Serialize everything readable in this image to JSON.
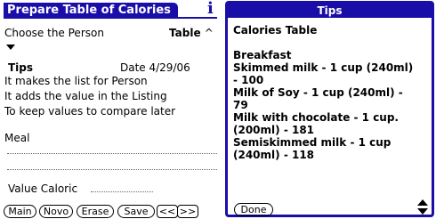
{
  "form": {
    "title": "Prepare Table of Calories",
    "info_icon": "i",
    "person_label": "Choose the Person",
    "category_trigger": "Table",
    "tips_label": "Tips",
    "date_label": "Date 4/29/06",
    "tip_lines": [
      "It makes the list for Person",
      "It adds the value in the Listing",
      "To keep values to compare later"
    ],
    "meal_label": "Meal",
    "value_caloric_label": "Value Caloric"
  },
  "buttons": {
    "main": "Main",
    "novo": "Novo",
    "erase": "Erase",
    "save": "Save",
    "prev": "<<",
    "next": ">>"
  },
  "dialog": {
    "title": "Tips",
    "body": "Calories Table\n\nBreakfast\nSkimmed milk - 1 cup (240ml)\n- 100\nMilk of Soy - 1 cup (240ml) -\n79\nMilk with chocolate - 1 cup.\n(200ml) - 181\nSemiskimmed milk - 1 cup\n(240ml) - 118",
    "done_label": "Done"
  },
  "colors": {
    "accent": "#1a0ea8"
  }
}
